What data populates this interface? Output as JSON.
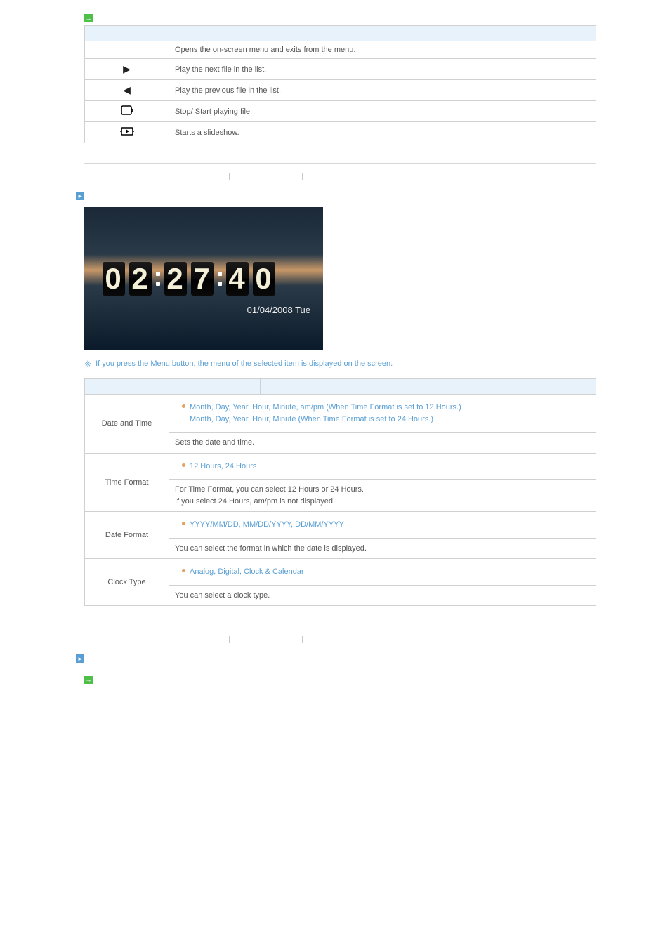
{
  "direct_functions": {
    "header_label": "",
    "cols": {
      "button": "",
      "description": ""
    },
    "rows": [
      {
        "icon": "",
        "desc": "Opens the on-screen menu and exits from the menu."
      },
      {
        "icon": "▶",
        "desc": "Play the next file in the list."
      },
      {
        "icon": "◀",
        "desc": "Play the previous file in the list."
      },
      {
        "icon": "rotate-icon",
        "desc": "Stop/ Start playing file."
      },
      {
        "icon": "slideshow-icon",
        "desc": "Starts a slideshow."
      }
    ]
  },
  "nav": {
    "items": [
      "",
      "",
      "",
      "",
      "",
      ""
    ]
  },
  "clock_section": {
    "title": "",
    "image": {
      "digits": [
        "0",
        "2",
        "2",
        "7",
        "4",
        "0"
      ],
      "date_line": "01/04/2008 Tue"
    },
    "note": "If you press the Menu button, the menu of the selected item is displayed on the screen."
  },
  "clock_table": {
    "cols": {
      "menu": "",
      "sub": "",
      "desc": ""
    },
    "rows": [
      {
        "menu": "Date and Time",
        "sub": "Month, Day, Year, Hour, Minute, am/pm (When Time Format is set to 12 Hours.)\nMonth, Day, Year, Hour, Minute (When Time Format is set to 24 Hours.)",
        "desc": "Sets the date and time."
      },
      {
        "menu": "Time Format",
        "sub": "12 Hours, 24 Hours",
        "desc": "For Time Format, you can select 12 Hours or 24 Hours.\nIf you select 24 Hours, am/pm is not displayed."
      },
      {
        "menu": "Date Format",
        "sub": "YYYY/MM/DD, MM/DD/YYYY, DD/MM/YYYY",
        "desc": "You can select the format in which the date is displayed."
      },
      {
        "menu": "Clock Type",
        "sub": "Analog, Digital, Clock & Calendar",
        "desc": "You can select a clock type."
      }
    ]
  },
  "bottom_section_title": "",
  "bottom_sub_title": ""
}
